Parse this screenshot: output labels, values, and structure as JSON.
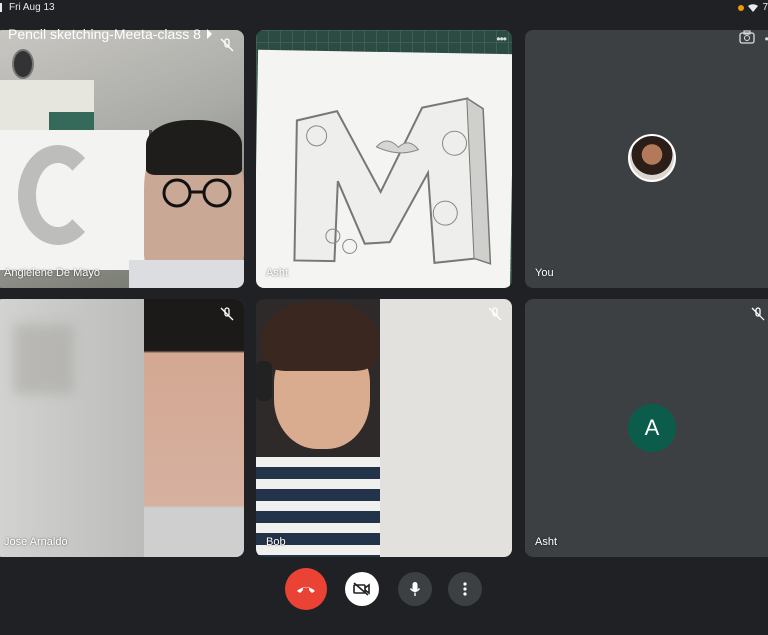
{
  "status_bar": {
    "time": "Fri Aug 13",
    "battery": "7"
  },
  "meeting": {
    "title": "Pencil sketching-Meeta-class 8"
  },
  "participants": [
    {
      "name": "Angielene De Mayo"
    },
    {
      "name": "Asht"
    },
    {
      "name": "You"
    },
    {
      "name": "Jose Arnaldo"
    },
    {
      "name": "Bob"
    },
    {
      "name": "Asht",
      "initial": "A"
    }
  ],
  "controls": {
    "end_call": "end-call-icon",
    "camera": "camera-off-icon",
    "mic": "mic-icon",
    "more": "more-vert-icon"
  },
  "colors": {
    "end_call": "#ea4335",
    "avatar_bg": "#0b5c4a",
    "background": "#202124",
    "tile": "#3c4043"
  }
}
